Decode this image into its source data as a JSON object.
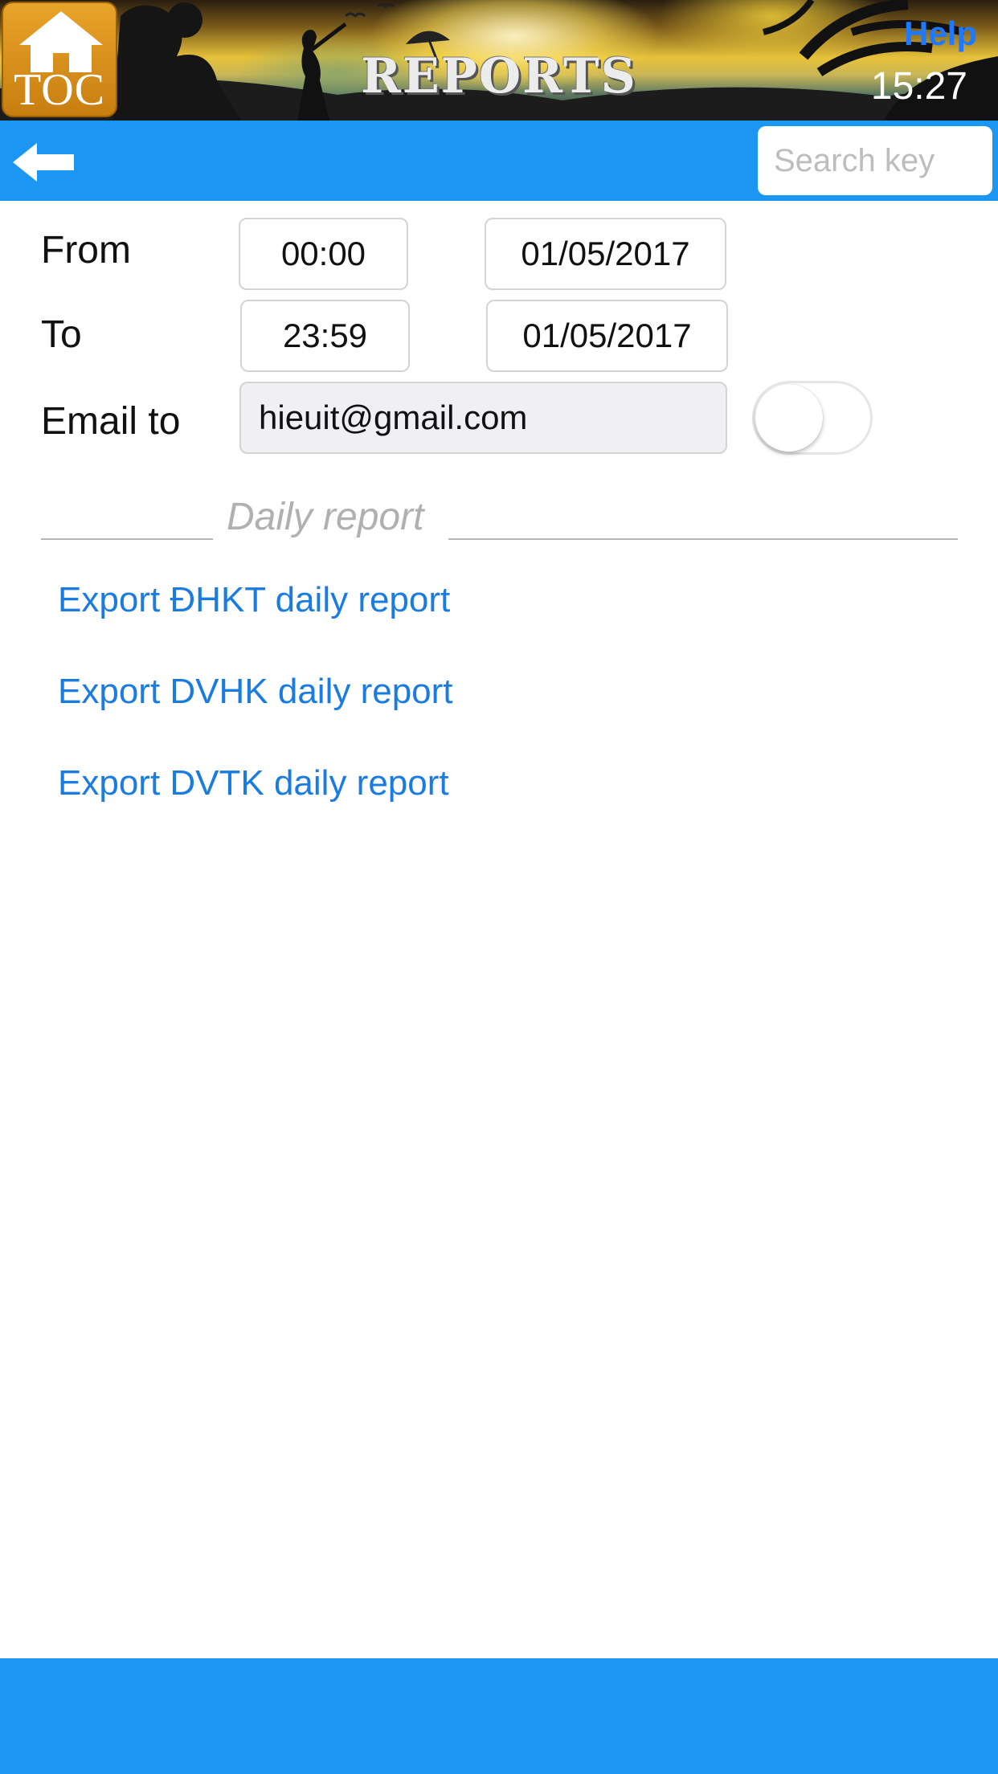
{
  "header": {
    "logo_text": "TOC",
    "title": "REPORTS",
    "help_label": "Help",
    "clock": "15:27"
  },
  "toolbar": {
    "search_placeholder": "Search key",
    "search_value": ""
  },
  "form": {
    "from_label": "From",
    "from_time": "00:00",
    "from_date": "01/05/2017",
    "to_label": "To",
    "to_time": "23:59",
    "to_date": "01/05/2017",
    "email_label": "Email to",
    "email_value": "hieuit@gmail.com",
    "email_toggle_on": false
  },
  "daily_section": {
    "title": "Daily report",
    "links": [
      "Export ĐHKT daily report",
      "Export DVHK daily report",
      "Export DVTK daily report"
    ]
  },
  "colors": {
    "toolbar_blue": "#1b97f3",
    "link_blue": "#1a7be0",
    "help_blue": "#1f79ff",
    "home_orange": "#d98f1c"
  }
}
